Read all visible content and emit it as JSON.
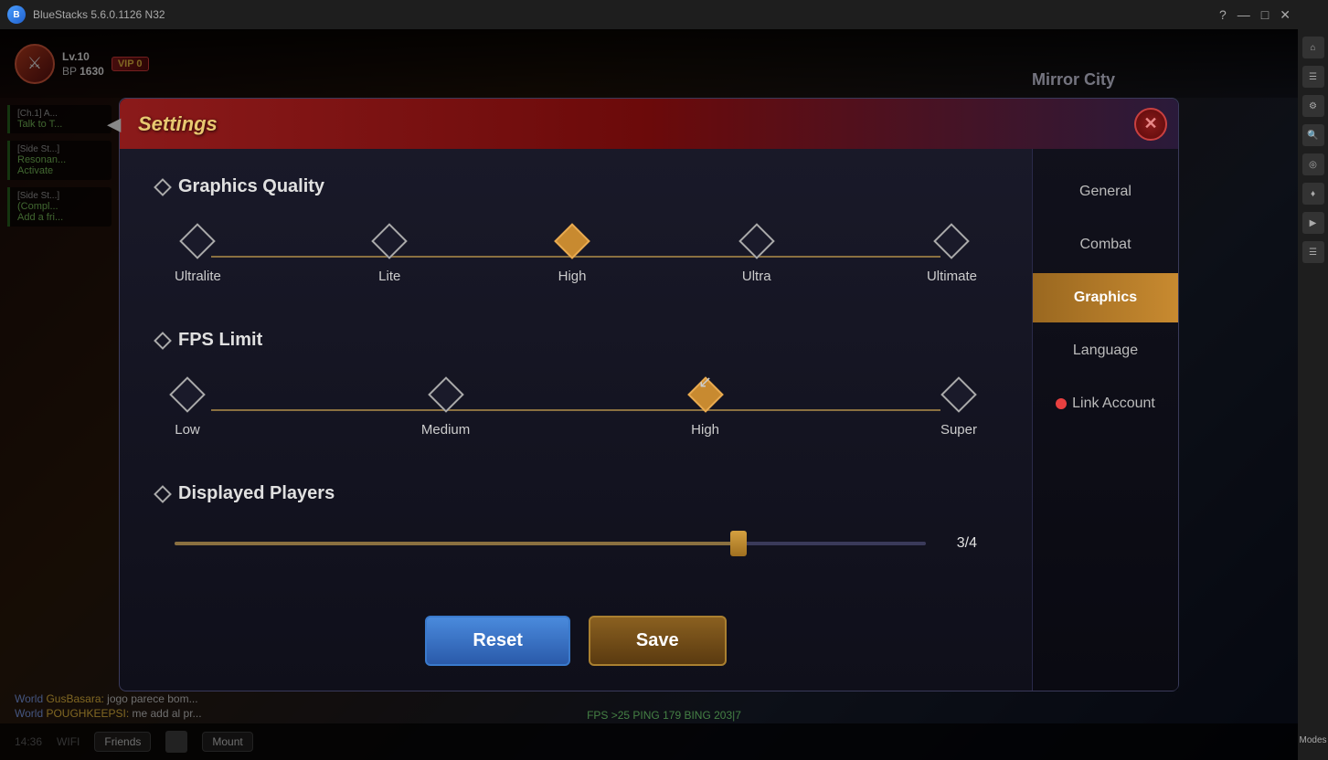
{
  "app": {
    "title": "BlueStacks 5.6.0.1126  N32",
    "version": "5.6.0.1126 N32"
  },
  "titlebar": {
    "help_icon": "?",
    "minimize_icon": "—",
    "restore_icon": "□",
    "close_icon": "✕"
  },
  "game": {
    "player": {
      "level": "Lv.10",
      "bp": "1630",
      "vip_label": "VIP",
      "vip_level": "0",
      "city_name": "Mirror City"
    },
    "quests": [
      {
        "type": "Ch.1",
        "label": "[Ch.1] A...",
        "description": "Talk to T..."
      },
      {
        "type": "Side St.",
        "label": "[Side St...]",
        "description": "Resonan... Activate"
      },
      {
        "type": "Side St.",
        "label": "[Side St...]",
        "description": "(Compl... Add a fri..."
      }
    ],
    "bottom_bar": {
      "friends_label": "Friends",
      "world_messages": [
        {
          "tag": "World",
          "user": "GusBasara:",
          "text": "jogo parece bom..."
        },
        {
          "tag": "World",
          "user": "POUGHKEEPSI:",
          "text": "me add al pr..."
        }
      ],
      "mount_label": "Mount"
    },
    "fps_text": "FPS >25  PING 179  BING 203|7",
    "status_bar": {
      "time": "14:36",
      "connection": "WIFI"
    }
  },
  "settings": {
    "title": "Settings",
    "close_button_label": "✕",
    "nav_items": [
      {
        "id": "general",
        "label": "General",
        "active": false
      },
      {
        "id": "combat",
        "label": "Combat",
        "active": false
      },
      {
        "id": "graphics",
        "label": "Graphics",
        "active": true
      },
      {
        "id": "language",
        "label": "Language",
        "active": false
      },
      {
        "id": "link_account",
        "label": "Link Account",
        "active": false,
        "has_dot": true
      }
    ],
    "sections": {
      "graphics_quality": {
        "title": "Graphics Quality",
        "options": [
          {
            "id": "ultralite",
            "label": "Ultralite",
            "active": false
          },
          {
            "id": "lite",
            "label": "Lite",
            "active": false
          },
          {
            "id": "high",
            "label": "High",
            "active": true
          },
          {
            "id": "ultra",
            "label": "Ultra",
            "active": false
          },
          {
            "id": "ultimate",
            "label": "Ultimate",
            "active": false
          }
        ]
      },
      "fps_limit": {
        "title": "FPS Limit",
        "options": [
          {
            "id": "low",
            "label": "Low",
            "active": false
          },
          {
            "id": "medium",
            "label": "Medium",
            "active": false
          },
          {
            "id": "high",
            "label": "High",
            "active": true
          },
          {
            "id": "super",
            "label": "Super",
            "active": false
          }
        ]
      },
      "displayed_players": {
        "title": "Displayed Players",
        "current_value": "3/4",
        "slider_percent": 75
      }
    },
    "buttons": {
      "reset_label": "Reset",
      "save_label": "Save"
    }
  }
}
